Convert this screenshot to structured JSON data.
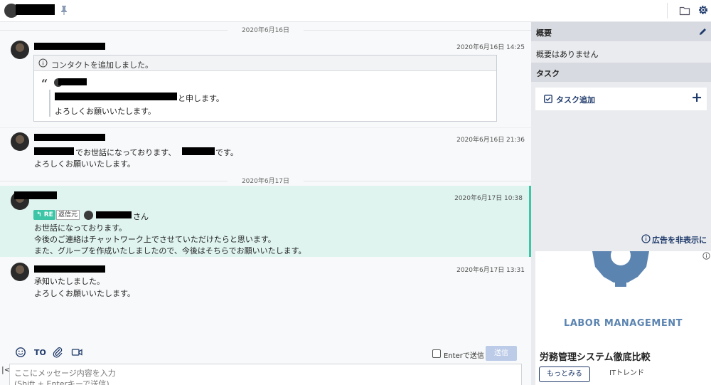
{
  "header": {
    "room_title": ""
  },
  "messages": [
    {
      "date_separator": "2020年6月16日",
      "time": "2020年6月16日 14:25",
      "info_title": "コンタクトを追加しました。",
      "quote_lines": [
        "と申します。",
        "よろしくお願いいたします。"
      ]
    },
    {
      "time": "2020年6月16日 21:36",
      "lines": [
        "でお世話になっております、",
        "です。",
        "よろしくお願いいたします。"
      ]
    },
    {
      "date_separator": "2020年6月17日",
      "time": "2020年6月17日 10:38",
      "re_label": "RE",
      "reply_source": "返信元",
      "reply_suffix": "さん",
      "lines": [
        "お世話になっております。",
        "今後のご連絡はチャットワーク上でさせていただけたらと思います。",
        "また、グループを作成いたしましたので、今後はそちらでお願いいたします。"
      ]
    },
    {
      "time": "2020年6月17日 13:31",
      "lines": [
        "承知いたしました。",
        "よろしくお願いいたします。"
      ]
    }
  ],
  "composer": {
    "to_label": "TO",
    "enter_send_label": "Enterで送信",
    "send_label": "送信",
    "placeholder": "ここにメッセージ内容を入力\n(Shift + Enterキーで送信)"
  },
  "sidebar": {
    "summary_title": "概要",
    "summary_text": "概要はありません",
    "task_title": "タスク",
    "add_task_label": "タスク追加",
    "hide_ad_label": "広告を非表示に"
  },
  "ad": {
    "brand": "LABOR MANAGEMENT",
    "title": "労務管理システム徹底比較",
    "more_label": "もっとみる",
    "source": "ITトレンド"
  },
  "colors": {
    "accent": "#3cc5a6",
    "highlight_bg": "#dff4ef",
    "sidebar_bg": "#e9ebee",
    "link": "#1f3a6b",
    "send_button": "#bccbe8"
  }
}
